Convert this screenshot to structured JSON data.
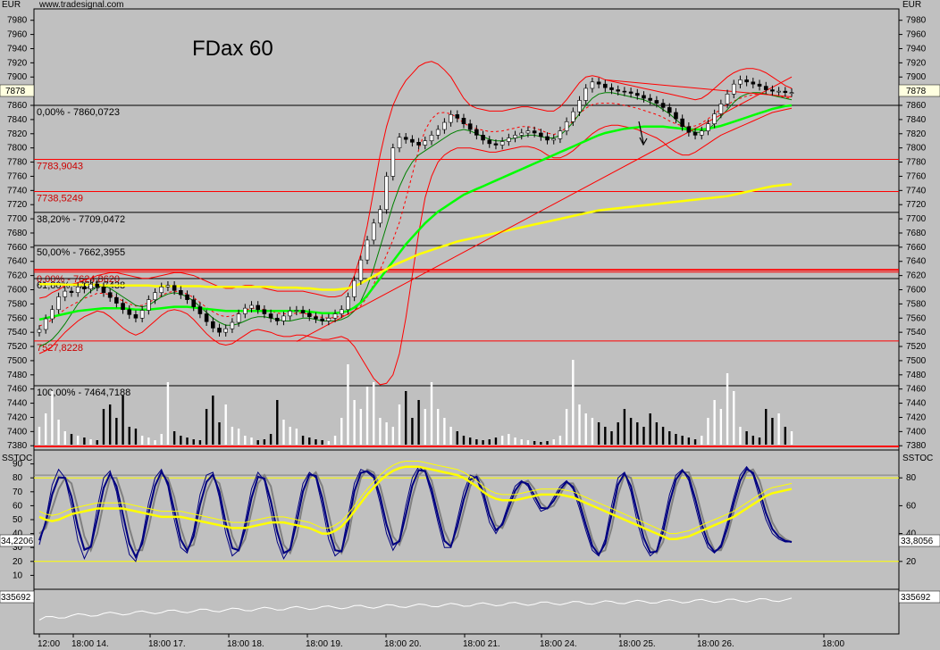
{
  "header": {
    "currency": "EUR",
    "source": "www.tradesignal.com",
    "title": "FDax 60",
    "current_price": "7878"
  },
  "colors": {
    "background": "#c0c0c0",
    "bollinger": "#ff0000",
    "sma_fast": "#008000",
    "sma_green": "#00ff00",
    "sma_yellow": "#ffff00",
    "volume_up": "#ffffff",
    "volume_down": "#000000",
    "stoch_main": "#000080",
    "stoch_signal": "#808080",
    "fib_line": "#000000",
    "level_line": "#ff0000"
  },
  "price_panel": {
    "ylim": [
      7374,
      7996
    ],
    "yticks": [
      7980,
      7960,
      7940,
      7920,
      7900,
      7880,
      7860,
      7840,
      7820,
      7800,
      7780,
      7760,
      7740,
      7720,
      7700,
      7680,
      7660,
      7640,
      7620,
      7600,
      7580,
      7560,
      7540,
      7520,
      7500,
      7480,
      7460,
      7440,
      7420,
      7400,
      7380
    ],
    "levels": [
      {
        "label": "0,00% - 7860,0723",
        "value": 7860.0723,
        "kind": "fib"
      },
      {
        "label": "7783,9043",
        "value": 7783.9043,
        "kind": "level"
      },
      {
        "label": "7738,5249",
        "value": 7738.5249,
        "kind": "level"
      },
      {
        "label": "38,20% - 7709,0472",
        "value": 7709.0472,
        "kind": "fib"
      },
      {
        "label": "50,00% - 7662,3955",
        "value": 7662.3955,
        "kind": "fib"
      },
      {
        "label": "0,00% - 7624,8620",
        "value": 7624.862,
        "kind": "level"
      },
      {
        "label": "61,80% - 7615,7438",
        "value": 7615.7438,
        "kind": "fib"
      },
      {
        "label": "7527,8228",
        "value": 7527.8228,
        "kind": "level"
      },
      {
        "label": "100,00% - 7464,7188",
        "value": 7464.7188,
        "kind": "fib"
      },
      {
        "label": "",
        "value": 7379,
        "kind": "level"
      }
    ]
  },
  "stoch_panel": {
    "label": "SSTOC",
    "ylim": [
      0,
      100
    ],
    "yticks": [
      90,
      80,
      70,
      60,
      50,
      40,
      30,
      20,
      10
    ],
    "right_ticks": [
      80,
      60,
      40,
      20
    ],
    "left_value": "34,2206",
    "right_value": "33,8056",
    "bands": [
      80,
      20
    ]
  },
  "lower_panel": {
    "left_value": "335692",
    "right_value": "335692"
  },
  "x_axis": {
    "ticks": [
      "12:00",
      "18:00 14.",
      "18:00 17.",
      "18:00 18.",
      "18:00 19.",
      "18:00 20.",
      "18:00 21.",
      "18:00 24.",
      "18:00 25.",
      "18:00 26.",
      "18:00"
    ]
  },
  "chart_data": {
    "type": "candlestick",
    "title": "FDax 60",
    "ylabel": "EUR",
    "ylim": [
      7374,
      7996
    ],
    "grid": false,
    "candles": [
      7544,
      7559,
      7572,
      7590,
      7598,
      7596,
      7604,
      7601,
      7608,
      7604,
      7596,
      7589,
      7581,
      7572,
      7565,
      7560,
      7571,
      7586,
      7596,
      7604,
      7606,
      7599,
      7593,
      7586,
      7576,
      7566,
      7555,
      7546,
      7540,
      7545,
      7554,
      7566,
      7574,
      7578,
      7572,
      7566,
      7560,
      7556,
      7563,
      7570,
      7571,
      7567,
      7562,
      7559,
      7556,
      7560,
      7566,
      7572,
      7590,
      7613,
      7642,
      7670,
      7694,
      7713,
      7760,
      7800,
      7815,
      7812,
      7808,
      7804,
      7810,
      7818,
      7826,
      7836,
      7847,
      7842,
      7834,
      7826,
      7818,
      7811,
      7806,
      7804,
      7809,
      7814,
      7818,
      7821,
      7824,
      7821,
      7816,
      7811,
      7813,
      7824,
      7837,
      7851,
      7867,
      7884,
      7893,
      7890,
      7885,
      7882,
      7880,
      7879,
      7877,
      7874,
      7870,
      7867,
      7863,
      7857,
      7850,
      7841,
      7830,
      7822,
      7818,
      7824,
      7834,
      7848,
      7862,
      7876,
      7890,
      7896,
      7893,
      7890,
      7887,
      7882,
      7880,
      7880,
      7878,
      7878
    ],
    "bb_upper": [
      7588,
      7590,
      7596,
      7600,
      7606,
      7608,
      7610,
      7614,
      7616,
      7620,
      7622,
      7624,
      7624,
      7622,
      7620,
      7618,
      7616,
      7616,
      7618,
      7620,
      7622,
      7624,
      7624,
      7622,
      7620,
      7616,
      7612,
      7608,
      7604,
      7602,
      7602,
      7604,
      7606,
      7606,
      7604,
      7602,
      7600,
      7598,
      7598,
      7598,
      7598,
      7598,
      7596,
      7594,
      7592,
      7590,
      7590,
      7592,
      7600,
      7620,
      7650,
      7690,
      7740,
      7790,
      7830,
      7860,
      7880,
      7895,
      7905,
      7915,
      7920,
      7922,
      7918,
      7910,
      7900,
      7885,
      7870,
      7860,
      7856,
      7854,
      7852,
      7852,
      7852,
      7854,
      7856,
      7858,
      7858,
      7856,
      7854,
      7852,
      7852,
      7858,
      7868,
      7880,
      7892,
      7900,
      7902,
      7900,
      7896,
      7894,
      7892,
      7890,
      7888,
      7886,
      7884,
      7882,
      7880,
      7878,
      7876,
      7874,
      7872,
      7870,
      7868,
      7870,
      7876,
      7884,
      7892,
      7900,
      7906,
      7910,
      7912,
      7912,
      7910,
      7906,
      7900,
      7894,
      7888,
      7884
    ],
    "bb_lower": [
      7510,
      7514,
      7520,
      7530,
      7540,
      7548,
      7556,
      7562,
      7566,
      7570,
      7568,
      7562,
      7554,
      7546,
      7540,
      7536,
      7540,
      7548,
      7556,
      7564,
      7570,
      7572,
      7570,
      7566,
      7558,
      7548,
      7538,
      7530,
      7524,
      7522,
      7524,
      7530,
      7536,
      7542,
      7544,
      7542,
      7540,
      7536,
      7534,
      7534,
      7536,
      7536,
      7534,
      7532,
      7530,
      7530,
      7532,
      7534,
      7530,
      7520,
      7505,
      7490,
      7475,
      7466,
      7468,
      7480,
      7510,
      7560,
      7620,
      7680,
      7730,
      7760,
      7780,
      7790,
      7796,
      7800,
      7800,
      7800,
      7798,
      7796,
      7794,
      7794,
      7796,
      7798,
      7800,
      7802,
      7802,
      7800,
      7796,
      7790,
      7786,
      7786,
      7790,
      7796,
      7804,
      7812,
      7820,
      7826,
      7830,
      7832,
      7832,
      7830,
      7828,
      7826,
      7822,
      7818,
      7814,
      7808,
      7800,
      7794,
      7790,
      7790,
      7794,
      7800,
      7806,
      7812,
      7818,
      7822,
      7826,
      7830,
      7834,
      7838,
      7842,
      7846,
      7850,
      7852,
      7854,
      7856
    ],
    "sma_fast": [
      7520,
      7524,
      7530,
      7540,
      7552,
      7566,
      7580,
      7590,
      7598,
      7604,
      7606,
      7602,
      7596,
      7590,
      7584,
      7578,
      7576,
      7578,
      7584,
      7590,
      7594,
      7596,
      7594,
      7590,
      7584,
      7576,
      7568,
      7560,
      7554,
      7550,
      7550,
      7552,
      7556,
      7560,
      7562,
      7562,
      7560,
      7558,
      7556,
      7556,
      7558,
      7560,
      7560,
      7558,
      7556,
      7556,
      7556,
      7558,
      7562,
      7570,
      7584,
      7604,
      7630,
      7660,
      7690,
      7720,
      7745,
      7765,
      7780,
      7790,
      7796,
      7802,
      7808,
      7814,
      7820,
      7824,
      7826,
      7824,
      7820,
      7816,
      7812,
      7810,
      7810,
      7812,
      7814,
      7816,
      7818,
      7818,
      7816,
      7814,
      7814,
      7818,
      7826,
      7836,
      7848,
      7860,
      7870,
      7876,
      7878,
      7878,
      7876,
      7874,
      7872,
      7870,
      7868,
      7864,
      7860,
      7854,
      7848,
      7840,
      7832,
      7826,
      7822,
      7822,
      7826,
      7834,
      7844,
      7854,
      7864,
      7872,
      7876,
      7878,
      7878,
      7876,
      7874,
      7872,
      7870,
      7868
    ],
    "sma_green": [
      7558,
      7560,
      7562,
      7564,
      7566,
      7568,
      7570,
      7571,
      7572,
      7573,
      7574,
      7574,
      7574,
      7574,
      7573,
      7572,
      7572,
      7572,
      7573,
      7574,
      7575,
      7576,
      7576,
      7576,
      7575,
      7574,
      7573,
      7572,
      7571,
      7570,
      7570,
      7570,
      7570,
      7570,
      7570,
      7570,
      7570,
      7570,
      7570,
      7570,
      7570,
      7570,
      7569,
      7568,
      7567,
      7567,
      7567,
      7568,
      7570,
      7575,
      7582,
      7592,
      7604,
      7616,
      7628,
      7640,
      7652,
      7664,
      7674,
      7684,
      7694,
      7702,
      7710,
      7716,
      7722,
      7728,
      7734,
      7738,
      7742,
      7746,
      7750,
      7754,
      7758,
      7762,
      7766,
      7770,
      7774,
      7778,
      7782,
      7786,
      7790,
      7794,
      7798,
      7802,
      7806,
      7810,
      7814,
      7818,
      7821,
      7823,
      7825,
      7827,
      7828,
      7829,
      7830,
      7830,
      7830,
      7830,
      7829,
      7828,
      7827,
      7826,
      7826,
      7826,
      7827,
      7829,
      7831,
      7834,
      7837,
      7840,
      7843,
      7846,
      7849,
      7852,
      7855,
      7857,
      7859,
      7860
    ],
    "sma_yellow": [
      7608,
      7608,
      7608,
      7608,
      7607,
      7607,
      7607,
      7607,
      7607,
      7607,
      7606,
      7606,
      7606,
      7606,
      7606,
      7606,
      7606,
      7606,
      7605,
      7605,
      7605,
      7605,
      7605,
      7605,
      7605,
      7605,
      7604,
      7604,
      7604,
      7604,
      7604,
      7604,
      7604,
      7604,
      7604,
      7604,
      7604,
      7603,
      7603,
      7603,
      7603,
      7602,
      7602,
      7601,
      7600,
      7600,
      7600,
      7601,
      7602,
      7605,
      7609,
      7614,
      7619,
      7624,
      7629,
      7634,
      7638,
      7642,
      7646,
      7650,
      7653,
      7656,
      7659,
      7662,
      7665,
      7668,
      7670,
      7672,
      7674,
      7676,
      7678,
      7680,
      7682,
      7684,
      7686,
      7688,
      7690,
      7692,
      7694,
      7696,
      7698,
      7700,
      7702,
      7704,
      7706,
      7708,
      7710,
      7712,
      7713,
      7714,
      7715,
      7716,
      7717,
      7718,
      7719,
      7720,
      7721,
      7722,
      7723,
      7724,
      7725,
      7726,
      7727,
      7728,
      7729,
      7730,
      7731,
      7732,
      7734,
      7736,
      7738,
      7740,
      7742,
      7744,
      7746,
      7747,
      7748,
      7749
    ],
    "volume": [
      20,
      35,
      60,
      28,
      15,
      12,
      10,
      8,
      6,
      5,
      40,
      45,
      30,
      55,
      20,
      18,
      10,
      8,
      5,
      12,
      70,
      15,
      10,
      8,
      6,
      5,
      40,
      55,
      25,
      45,
      20,
      18,
      10,
      8,
      5,
      6,
      12,
      50,
      28,
      20,
      18,
      10,
      8,
      6,
      5,
      4,
      10,
      30,
      90,
      50,
      40,
      65,
      70,
      30,
      25,
      20,
      45,
      60,
      30,
      50,
      40,
      70,
      40,
      30,
      20,
      15,
      10,
      8,
      6,
      5,
      6,
      8,
      10,
      12,
      8,
      6,
      5,
      4,
      3,
      4,
      6,
      10,
      40,
      95,
      45,
      35,
      30,
      25,
      20,
      15,
      25,
      40,
      30,
      25,
      20,
      35,
      25,
      20,
      15,
      12,
      10,
      8,
      6,
      10,
      30,
      50,
      40,
      80,
      60,
      20,
      15,
      10,
      8,
      40,
      30,
      35,
      20,
      15
    ],
    "trendlines": [
      [
        40,
        7527,
        117,
        7900
      ],
      [
        88,
        7896,
        117,
        7872
      ]
    ],
    "stoch_k": [
      32,
      50,
      75,
      86,
      80,
      60,
      35,
      22,
      32,
      58,
      80,
      85,
      70,
      45,
      25,
      20,
      36,
      62,
      80,
      86,
      74,
      50,
      30,
      26,
      42,
      68,
      82,
      84,
      66,
      40,
      24,
      28,
      48,
      72,
      84,
      78,
      56,
      34,
      22,
      30,
      54,
      76,
      84,
      80,
      60,
      36,
      24,
      28,
      52,
      76,
      86,
      84,
      80,
      62,
      40,
      28,
      36,
      60,
      80,
      88,
      84,
      68,
      48,
      30,
      30,
      50,
      70,
      82,
      80,
      66,
      48,
      40,
      48,
      62,
      74,
      78,
      74,
      64,
      56,
      58,
      66,
      74,
      78,
      72,
      58,
      42,
      28,
      24,
      36,
      60,
      80,
      84,
      70,
      48,
      32,
      24,
      28,
      46,
      68,
      82,
      86,
      78,
      60,
      42,
      30,
      26,
      32,
      48,
      66,
      82,
      88,
      82,
      66,
      50,
      40,
      36,
      34,
      34
    ],
    "stoch_d": [
      40,
      44,
      58,
      72,
      80,
      76,
      58,
      38,
      28,
      40,
      62,
      80,
      80,
      66,
      44,
      28,
      28,
      44,
      66,
      82,
      80,
      66,
      44,
      30,
      32,
      50,
      70,
      80,
      76,
      58,
      38,
      28,
      36,
      56,
      76,
      82,
      74,
      52,
      32,
      26,
      38,
      62,
      80,
      84,
      74,
      54,
      34,
      26,
      36,
      62,
      80,
      86,
      84,
      74,
      56,
      38,
      32,
      44,
      66,
      82,
      86,
      78,
      60,
      42,
      32,
      38,
      56,
      74,
      82,
      76,
      60,
      46,
      44,
      54,
      66,
      76,
      78,
      72,
      62,
      58,
      60,
      68,
      76,
      76,
      68,
      52,
      36,
      26,
      28,
      44,
      68,
      82,
      80,
      64,
      44,
      30,
      26,
      34,
      54,
      74,
      84,
      84,
      72,
      54,
      38,
      28,
      28,
      38,
      56,
      72,
      84,
      86,
      78,
      62,
      48,
      40,
      36,
      34
    ],
    "stoch_slow": [
      52,
      50,
      49,
      50,
      52,
      54,
      55,
      56,
      57,
      58,
      58,
      58,
      58,
      58,
      57,
      56,
      55,
      54,
      53,
      52,
      52,
      52,
      52,
      51,
      50,
      49,
      48,
      47,
      46,
      45,
      44,
      44,
      44,
      45,
      46,
      47,
      48,
      48,
      48,
      47,
      46,
      45,
      44,
      42,
      40,
      40,
      42,
      45,
      50,
      56,
      62,
      68,
      73,
      78,
      82,
      85,
      87,
      88,
      88,
      88,
      87,
      86,
      85,
      84,
      83,
      82,
      80,
      77,
      74,
      70,
      67,
      65,
      64,
      64,
      64,
      65,
      66,
      67,
      68,
      68,
      68,
      68,
      67,
      66,
      64,
      62,
      60,
      58,
      56,
      54,
      52,
      50,
      48,
      46,
      44,
      42,
      40,
      38,
      36,
      36,
      37,
      38,
      40,
      42,
      44,
      46,
      48,
      50,
      52,
      55,
      58,
      61,
      64,
      67,
      69,
      70,
      71,
      72
    ]
  }
}
